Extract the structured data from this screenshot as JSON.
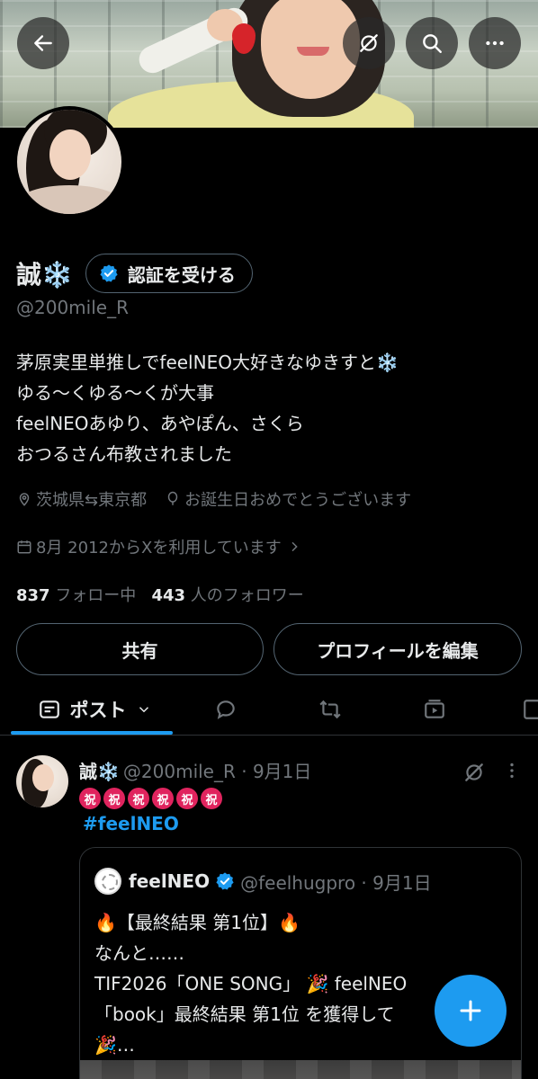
{
  "profile": {
    "name": "誠❄️",
    "verify_label": "認証を受ける",
    "handle": "@200mile_R",
    "bio": [
      "茅原実里単推しでfeelNEO大好きなゆきすと❄️",
      "ゆる～くゆる～くが大事",
      "feelNEOあゆり、あやぽん、さくら",
      "おつるさん布教されました"
    ],
    "location": "茨城県⇆東京都",
    "birthday": "お誕生日おめでとうございます",
    "joined": "8月 2012からXを利用しています",
    "following_count": "837",
    "following_label": "フォロー中",
    "followers_count": "443",
    "followers_label": "人のフォロワー"
  },
  "buttons": {
    "share": "共有",
    "edit_profile": "プロフィールを編集"
  },
  "tabs": {
    "posts": "ポスト"
  },
  "post": {
    "author": "誠❄️",
    "meta": "@200mile_R · 9月1日",
    "emoji_label": "祝",
    "hashtag": "#feelNEO",
    "quote": {
      "author": "feelNEO",
      "meta": "@feelhugpro · 9月1日",
      "lines": [
        "🔥【最終結果 第1位】🔥",
        "なんと……",
        "TIF2026「ONE SONG」 🎉 feelNEO",
        "「book」最終結果 第1位 を獲得して",
        "🎉…"
      ]
    }
  },
  "colors": {
    "accent": "#1d9bf0",
    "background": "#000000",
    "muted": "#71767b",
    "border": "#2f3336"
  }
}
